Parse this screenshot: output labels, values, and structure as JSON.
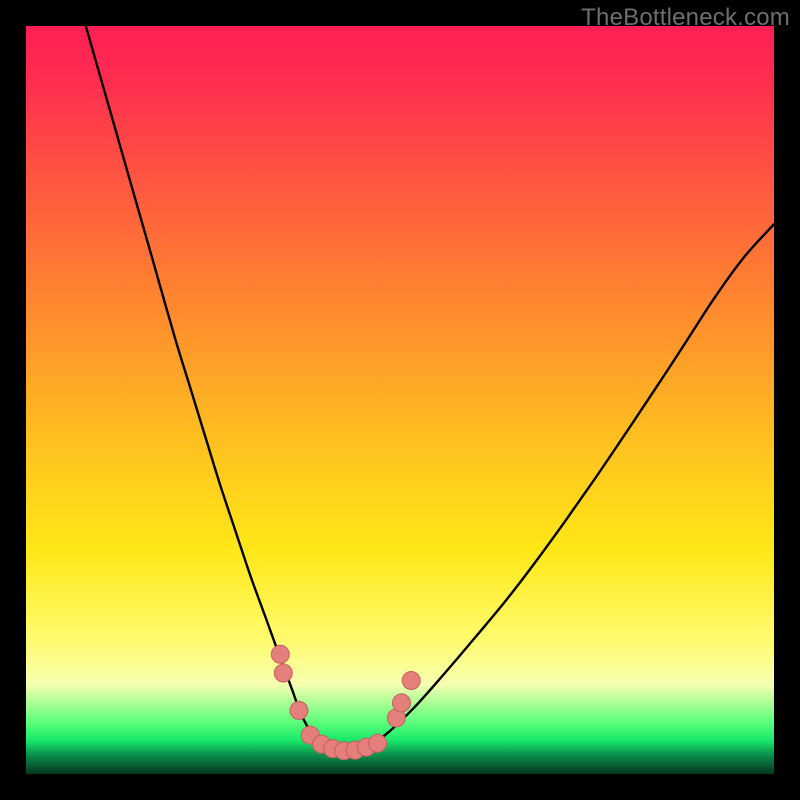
{
  "watermark": {
    "text": "TheBottleneck.com"
  },
  "colors": {
    "curve_stroke": "#000000",
    "marker_fill": "#e57f7c",
    "marker_stroke": "#c46160"
  },
  "chart_data": {
    "type": "line",
    "title": "",
    "xlabel": "",
    "ylabel": "",
    "xlim": [
      0,
      100
    ],
    "ylim": [
      0,
      100
    ],
    "grid": false,
    "legend": false,
    "series": [
      {
        "name": "bottleneck-curve",
        "x": [
          8,
          10,
          12,
          14,
          16,
          18,
          20,
          22,
          24,
          26,
          28,
          30,
          32,
          34,
          35.5,
          37,
          39,
          41,
          43,
          45,
          48,
          52,
          56,
          60,
          64,
          68,
          72,
          76,
          80,
          84,
          88,
          92,
          96,
          100
        ],
        "y": [
          100,
          93,
          86,
          79,
          72,
          65,
          58,
          51.5,
          45,
          38.5,
          32.5,
          26.5,
          21,
          15.5,
          11.5,
          7.5,
          4.5,
          3.3,
          3.0,
          3.4,
          5.2,
          9.0,
          13.5,
          18.2,
          23.0,
          28.2,
          33.7,
          39.4,
          45.3,
          51.3,
          57.4,
          63.6,
          69.1,
          73.5
        ]
      }
    ],
    "markers": [
      {
        "x": 34.0,
        "y": 16.0
      },
      {
        "x": 34.4,
        "y": 13.5
      },
      {
        "x": 36.5,
        "y": 8.5
      },
      {
        "x": 38.0,
        "y": 5.2
      },
      {
        "x": 39.5,
        "y": 4.0
      },
      {
        "x": 41.0,
        "y": 3.4
      },
      {
        "x": 42.5,
        "y": 3.1
      },
      {
        "x": 44.0,
        "y": 3.2
      },
      {
        "x": 45.5,
        "y": 3.6
      },
      {
        "x": 47.0,
        "y": 4.1
      },
      {
        "x": 49.5,
        "y": 7.5
      },
      {
        "x": 50.2,
        "y": 9.5
      },
      {
        "x": 51.5,
        "y": 12.5
      }
    ]
  }
}
